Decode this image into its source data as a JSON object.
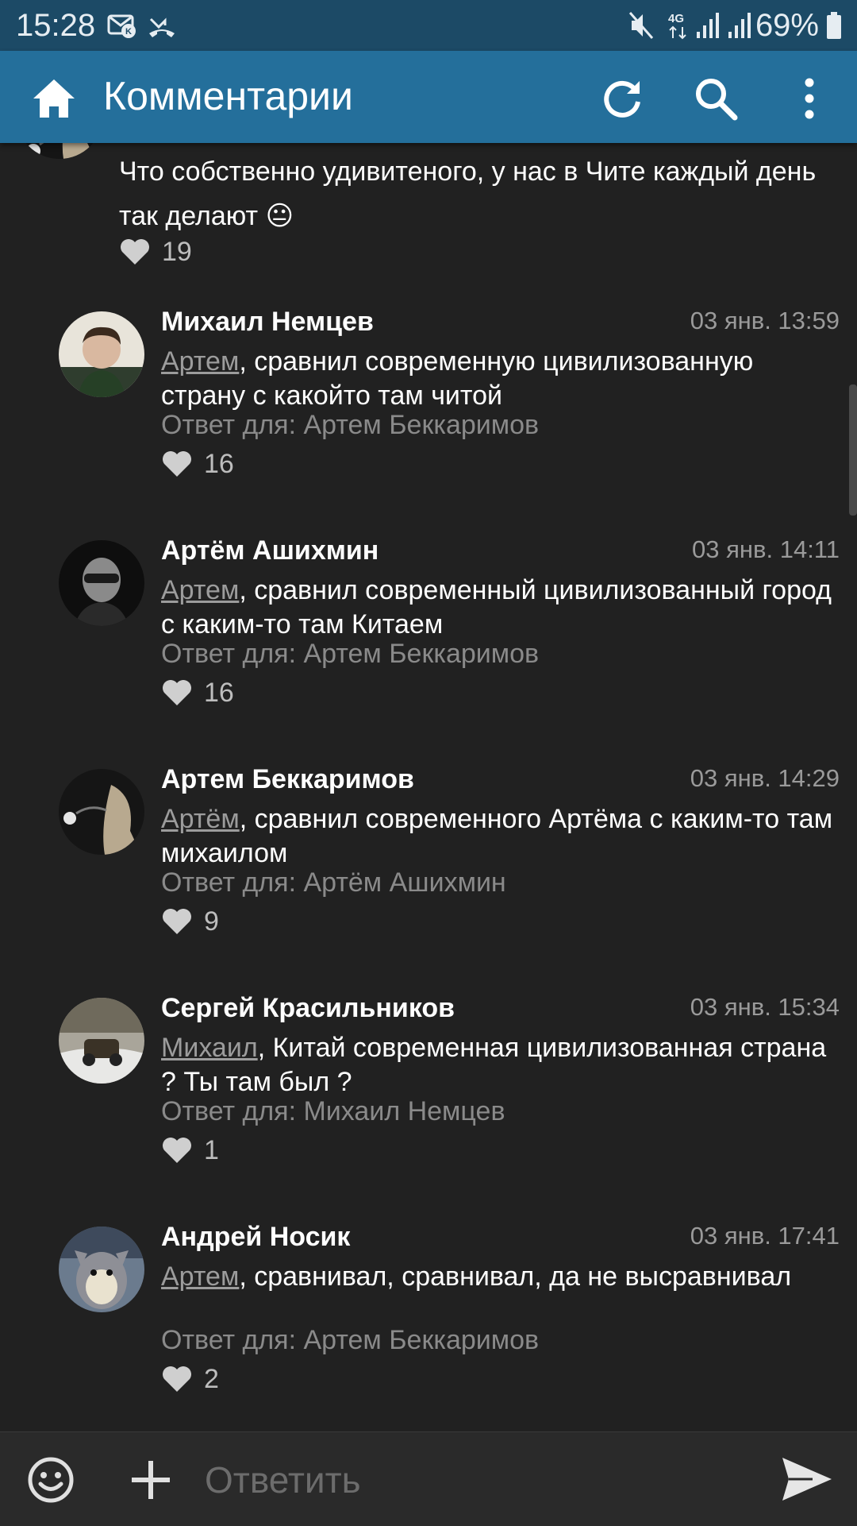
{
  "status_bar": {
    "time": "15:28",
    "battery": "69%",
    "icons": [
      "vk-notification-icon",
      "missed-call-icon",
      "mute-icon",
      "4g-icon",
      "signal-icon",
      "signal-icon",
      "battery-icon"
    ]
  },
  "app_bar": {
    "title": "Комментарии",
    "icons": [
      "home-icon",
      "refresh-icon",
      "search-icon",
      "more-vert-icon"
    ],
    "color": "#246f9b"
  },
  "top_comment": {
    "text": "Что собственно удивитеного, у нас в Чите каждый день так делают",
    "emoji": "😐",
    "likes": "19"
  },
  "comments": [
    {
      "name": "Михаил Немцев",
      "date": "03 янв. 13:59",
      "mention": "Артем",
      "text": ", сравнил современную цивилизованную страну с какойто там читой",
      "reply_to": "Ответ для: Артем Беккаримов",
      "likes": "16"
    },
    {
      "name": "Артём Ашихмин",
      "date": "03 янв. 14:11",
      "mention": "Артем",
      "text": ", сравнил современный цивилизованный город с каким-то там Китаем",
      "reply_to": "Ответ для: Артем Беккаримов",
      "likes": "16"
    },
    {
      "name": "Артем Беккаримов",
      "date": "03 янв. 14:29",
      "mention": "Артём",
      "text": ", сравнил современного Артёма с каким-то там михаилом",
      "reply_to": "Ответ для: Артём Ашихмин",
      "likes": "9"
    },
    {
      "name": "Сергей Красильников",
      "date": "03 янв. 15:34",
      "mention": "Михаил",
      "text": ", Китай современная цивилизованная страна ? Ты там был ?",
      "reply_to": "Ответ для: Михаил Немцев",
      "likes": "1"
    },
    {
      "name": "Андрей Носик",
      "date": "03 янв. 17:41",
      "mention": "Артем",
      "text": ", сравнивал, сравнивал, да не высравнивал",
      "reply_to": "Ответ для: Артем Беккаримов",
      "likes": "2"
    }
  ],
  "bottom_bar": {
    "placeholder": "Ответить",
    "icons": [
      "emoji-icon",
      "add-icon",
      "send-icon"
    ]
  }
}
